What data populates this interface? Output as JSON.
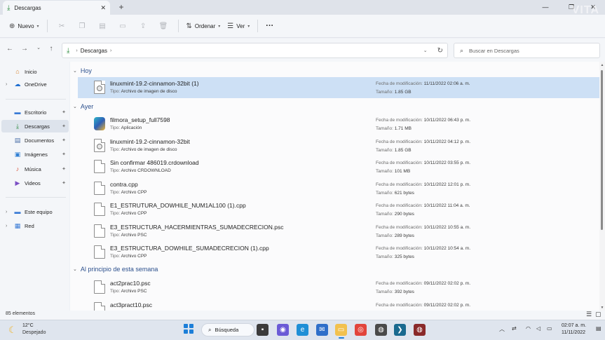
{
  "window": {
    "tab_title": "Descargas",
    "new_tab": "+",
    "minimize": "—",
    "maximize": "❐",
    "close": "✕",
    "watermark": "VITA"
  },
  "toolbar": {
    "new_label": "Nuevo",
    "sort_label": "Ordenar",
    "view_label": "Ver",
    "more_label": "···"
  },
  "address": {
    "crumb": "Descargas",
    "search_placeholder": "Buscar en Descargas"
  },
  "sidebar": {
    "items": [
      {
        "label": "Inicio",
        "icon": "home-icon",
        "pinned": false
      },
      {
        "label": "OneDrive",
        "icon": "cloud-icon",
        "pinned": false
      },
      {
        "label": "Escritorio",
        "icon": "desktop-icon",
        "pinned": true
      },
      {
        "label": "Descargas",
        "icon": "download-icon",
        "pinned": true
      },
      {
        "label": "Documentos",
        "icon": "documents-icon",
        "pinned": true
      },
      {
        "label": "Imágenes",
        "icon": "pictures-icon",
        "pinned": true
      },
      {
        "label": "Música",
        "icon": "music-icon",
        "pinned": true
      },
      {
        "label": "Videos",
        "icon": "videos-icon",
        "pinned": true
      },
      {
        "label": "Este equipo",
        "icon": "computer-icon",
        "pinned": false
      },
      {
        "label": "Red",
        "icon": "network-icon",
        "pinned": false
      }
    ]
  },
  "groups": [
    {
      "label": "Hoy"
    },
    {
      "label": "Ayer"
    },
    {
      "label": "Al principio de esta semana"
    }
  ],
  "labels": {
    "type": "Tipo:",
    "modified": "Fecha de modificación:",
    "size": "Tamaño:"
  },
  "files": [
    {
      "name": "linuxmint-19.2-cinnamon-32bit (1)",
      "type": "Archivo de imagen de disco",
      "date": "11/11/2022 02:06 a. m.",
      "size": "1.85 GB",
      "icon": "disc-image-icon"
    },
    {
      "name": "filmora_setup_full7598",
      "type": "Aplicación",
      "date": "10/11/2022 06:43 p. m.",
      "size": "1.71 MB",
      "icon": "application-icon"
    },
    {
      "name": "linuxmint-19.2-cinnamon-32bit",
      "type": "Archivo de imagen de disco",
      "date": "10/11/2022 04:12 p. m.",
      "size": "1.85 GB",
      "icon": "disc-image-icon"
    },
    {
      "name": "Sin confirmar 486019.crdownload",
      "type": "Archivo CRDOWNLOAD",
      "date": "10/11/2022 03:55 p. m.",
      "size": "101 MB",
      "icon": "file-icon"
    },
    {
      "name": "contra.cpp",
      "type": "Archivo CPP",
      "date": "10/11/2022 12:01 p. m.",
      "size": "621 bytes",
      "icon": "file-icon"
    },
    {
      "name": "E1_ESTRUTURA_DOWHILE_NUM1AL100 (1).cpp",
      "type": "Archivo CPP",
      "date": "10/11/2022 11:04 a. m.",
      "size": "290 bytes",
      "icon": "file-icon"
    },
    {
      "name": "E3_ESTRUCTURA_HACERMIENTRAS_SUMADECRECION.psc",
      "type": "Archivo PSC",
      "date": "10/11/2022 10:55 a. m.",
      "size": "289 bytes",
      "icon": "file-icon"
    },
    {
      "name": "E3_ESTRUCTURA_DOWHILE_SUMADECRECION (1).cpp",
      "type": "Archivo CPP",
      "date": "10/11/2022 10:54 a. m.",
      "size": "325 bytes",
      "icon": "file-icon"
    },
    {
      "name": "act2prac10.psc",
      "type": "Archivo PSC",
      "date": "09/11/2022 02:02 p. m.",
      "size": "392 bytes",
      "icon": "file-icon"
    },
    {
      "name": "act3pract10.psc",
      "type": "",
      "date": "09/11/2022 02:02 p. m.",
      "size": "",
      "icon": "file-icon"
    }
  ],
  "status": {
    "count": "85 elementos"
  },
  "taskbar": {
    "temp": "12°C",
    "weather": "Despejado",
    "search": "Búsqueda",
    "time": "02:07 a. m.",
    "date": "11/11/2022"
  }
}
